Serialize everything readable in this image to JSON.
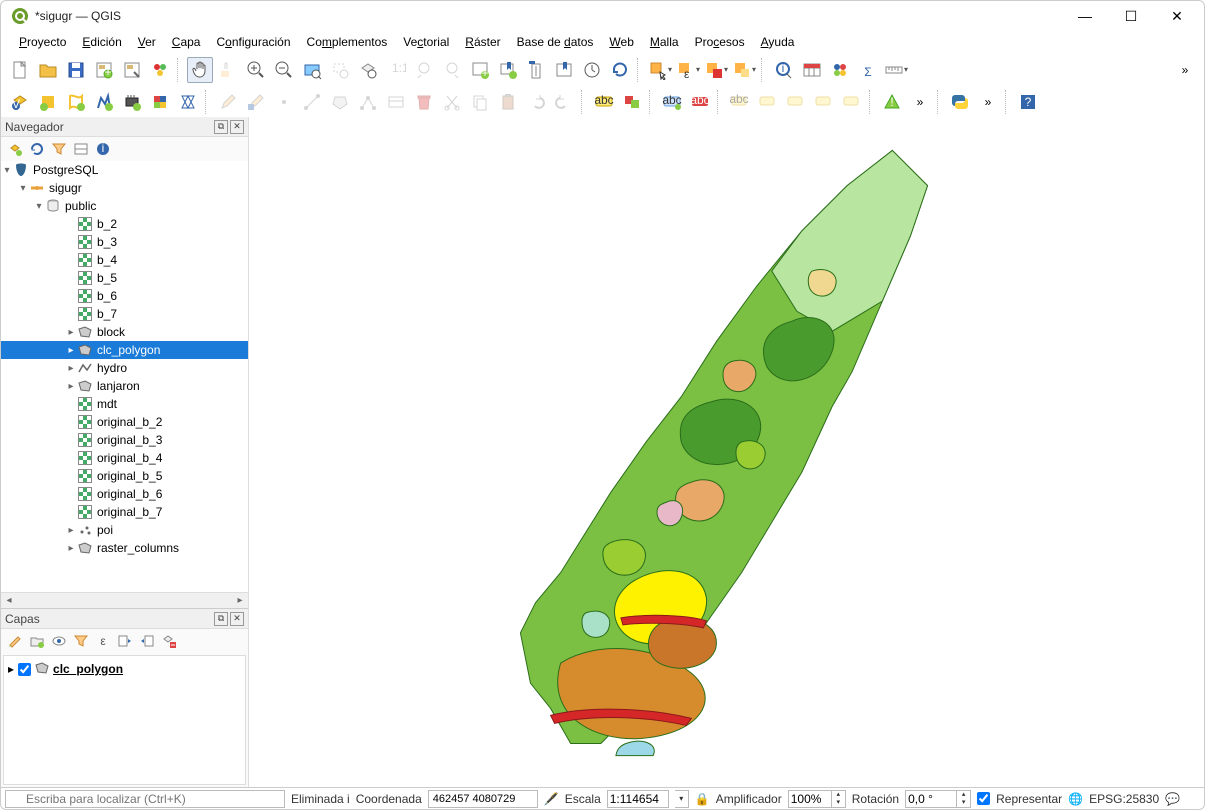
{
  "window": {
    "title": "*sigugr — QGIS"
  },
  "menu": [
    "Proyecto",
    "Edición",
    "Ver",
    "Capa",
    "Configuración",
    "Complementos",
    "Vectorial",
    "Ráster",
    "Base de datos",
    "Web",
    "Malla",
    "Procesos",
    "Ayuda"
  ],
  "menu_underline": [
    "P",
    "E",
    "V",
    "C",
    "o",
    "m",
    "c",
    "R",
    "d",
    "W",
    "M",
    "P",
    "A"
  ],
  "panels": {
    "browser": {
      "title": "Navegador"
    },
    "layers": {
      "title": "Capas"
    }
  },
  "browser_tree": {
    "root": "PostgreSQL",
    "conn": "sigugr",
    "schema": "public",
    "items": [
      {
        "name": "b_2",
        "icon": "raster",
        "indent": 4
      },
      {
        "name": "b_3",
        "icon": "raster",
        "indent": 4
      },
      {
        "name": "b_4",
        "icon": "raster",
        "indent": 4
      },
      {
        "name": "b_5",
        "icon": "raster",
        "indent": 4
      },
      {
        "name": "b_6",
        "icon": "raster",
        "indent": 4
      },
      {
        "name": "b_7",
        "icon": "raster",
        "indent": 4
      },
      {
        "name": "block",
        "icon": "poly",
        "indent": 4,
        "exp": "▸"
      },
      {
        "name": "clc_polygon",
        "icon": "poly",
        "indent": 4,
        "exp": "▸",
        "selected": true
      },
      {
        "name": "hydro",
        "icon": "line",
        "indent": 4,
        "exp": "▸"
      },
      {
        "name": "lanjaron",
        "icon": "poly",
        "indent": 4,
        "exp": "▸"
      },
      {
        "name": "mdt",
        "icon": "raster",
        "indent": 4
      },
      {
        "name": "original_b_2",
        "icon": "raster",
        "indent": 4
      },
      {
        "name": "original_b_3",
        "icon": "raster",
        "indent": 4
      },
      {
        "name": "original_b_4",
        "icon": "raster",
        "indent": 4
      },
      {
        "name": "original_b_5",
        "icon": "raster",
        "indent": 4
      },
      {
        "name": "original_b_6",
        "icon": "raster",
        "indent": 4
      },
      {
        "name": "original_b_7",
        "icon": "raster",
        "indent": 4
      },
      {
        "name": "poi",
        "icon": "point",
        "indent": 4,
        "exp": "▸"
      },
      {
        "name": "raster_columns",
        "icon": "poly",
        "indent": 4,
        "exp": "▸"
      }
    ]
  },
  "layers_tree": {
    "items": [
      {
        "name": "clc_polygon",
        "checked": true,
        "bold": true
      }
    ]
  },
  "status": {
    "locator_placeholder": "Escriba para localizar (Ctrl+K)",
    "eliminated_label": "Eliminada i",
    "coord_label": "Coordenada",
    "coord_value": "462457 4080729",
    "scale_label": "Escala",
    "scale_value": "1:114654",
    "mag_label": "Amplificador",
    "mag_value": "100%",
    "rot_label": "Rotación",
    "rot_value": "0,0 °",
    "render_label": "Representar",
    "crs_label": "EPSG:25830"
  }
}
